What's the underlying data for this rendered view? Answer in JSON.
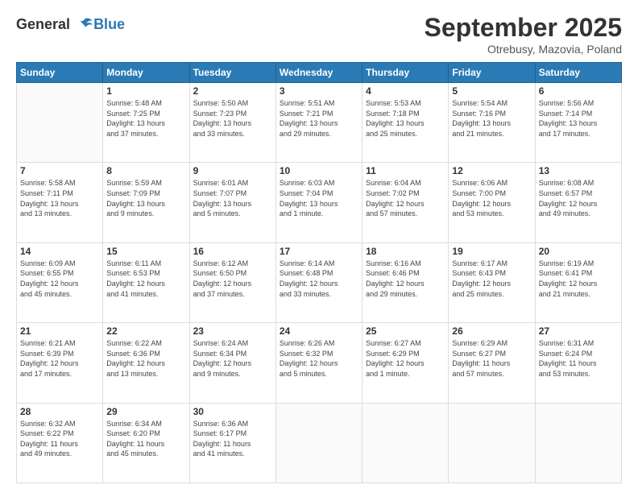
{
  "logo": {
    "line1": "General",
    "line2": "Blue"
  },
  "header": {
    "month": "September 2025",
    "location": "Otrebusy, Mazovia, Poland"
  },
  "weekdays": [
    "Sunday",
    "Monday",
    "Tuesday",
    "Wednesday",
    "Thursday",
    "Friday",
    "Saturday"
  ],
  "weeks": [
    [
      {
        "day": "",
        "info": ""
      },
      {
        "day": "1",
        "info": "Sunrise: 5:48 AM\nSunset: 7:25 PM\nDaylight: 13 hours\nand 37 minutes."
      },
      {
        "day": "2",
        "info": "Sunrise: 5:50 AM\nSunset: 7:23 PM\nDaylight: 13 hours\nand 33 minutes."
      },
      {
        "day": "3",
        "info": "Sunrise: 5:51 AM\nSunset: 7:21 PM\nDaylight: 13 hours\nand 29 minutes."
      },
      {
        "day": "4",
        "info": "Sunrise: 5:53 AM\nSunset: 7:18 PM\nDaylight: 13 hours\nand 25 minutes."
      },
      {
        "day": "5",
        "info": "Sunrise: 5:54 AM\nSunset: 7:16 PM\nDaylight: 13 hours\nand 21 minutes."
      },
      {
        "day": "6",
        "info": "Sunrise: 5:56 AM\nSunset: 7:14 PM\nDaylight: 13 hours\nand 17 minutes."
      }
    ],
    [
      {
        "day": "7",
        "info": "Sunrise: 5:58 AM\nSunset: 7:11 PM\nDaylight: 13 hours\nand 13 minutes."
      },
      {
        "day": "8",
        "info": "Sunrise: 5:59 AM\nSunset: 7:09 PM\nDaylight: 13 hours\nand 9 minutes."
      },
      {
        "day": "9",
        "info": "Sunrise: 6:01 AM\nSunset: 7:07 PM\nDaylight: 13 hours\nand 5 minutes."
      },
      {
        "day": "10",
        "info": "Sunrise: 6:03 AM\nSunset: 7:04 PM\nDaylight: 13 hours\nand 1 minute."
      },
      {
        "day": "11",
        "info": "Sunrise: 6:04 AM\nSunset: 7:02 PM\nDaylight: 12 hours\nand 57 minutes."
      },
      {
        "day": "12",
        "info": "Sunrise: 6:06 AM\nSunset: 7:00 PM\nDaylight: 12 hours\nand 53 minutes."
      },
      {
        "day": "13",
        "info": "Sunrise: 6:08 AM\nSunset: 6:57 PM\nDaylight: 12 hours\nand 49 minutes."
      }
    ],
    [
      {
        "day": "14",
        "info": "Sunrise: 6:09 AM\nSunset: 6:55 PM\nDaylight: 12 hours\nand 45 minutes."
      },
      {
        "day": "15",
        "info": "Sunrise: 6:11 AM\nSunset: 6:53 PM\nDaylight: 12 hours\nand 41 minutes."
      },
      {
        "day": "16",
        "info": "Sunrise: 6:12 AM\nSunset: 6:50 PM\nDaylight: 12 hours\nand 37 minutes."
      },
      {
        "day": "17",
        "info": "Sunrise: 6:14 AM\nSunset: 6:48 PM\nDaylight: 12 hours\nand 33 minutes."
      },
      {
        "day": "18",
        "info": "Sunrise: 6:16 AM\nSunset: 6:46 PM\nDaylight: 12 hours\nand 29 minutes."
      },
      {
        "day": "19",
        "info": "Sunrise: 6:17 AM\nSunset: 6:43 PM\nDaylight: 12 hours\nand 25 minutes."
      },
      {
        "day": "20",
        "info": "Sunrise: 6:19 AM\nSunset: 6:41 PM\nDaylight: 12 hours\nand 21 minutes."
      }
    ],
    [
      {
        "day": "21",
        "info": "Sunrise: 6:21 AM\nSunset: 6:39 PM\nDaylight: 12 hours\nand 17 minutes."
      },
      {
        "day": "22",
        "info": "Sunrise: 6:22 AM\nSunset: 6:36 PM\nDaylight: 12 hours\nand 13 minutes."
      },
      {
        "day": "23",
        "info": "Sunrise: 6:24 AM\nSunset: 6:34 PM\nDaylight: 12 hours\nand 9 minutes."
      },
      {
        "day": "24",
        "info": "Sunrise: 6:26 AM\nSunset: 6:32 PM\nDaylight: 12 hours\nand 5 minutes."
      },
      {
        "day": "25",
        "info": "Sunrise: 6:27 AM\nSunset: 6:29 PM\nDaylight: 12 hours\nand 1 minute."
      },
      {
        "day": "26",
        "info": "Sunrise: 6:29 AM\nSunset: 6:27 PM\nDaylight: 11 hours\nand 57 minutes."
      },
      {
        "day": "27",
        "info": "Sunrise: 6:31 AM\nSunset: 6:24 PM\nDaylight: 11 hours\nand 53 minutes."
      }
    ],
    [
      {
        "day": "28",
        "info": "Sunrise: 6:32 AM\nSunset: 6:22 PM\nDaylight: 11 hours\nand 49 minutes."
      },
      {
        "day": "29",
        "info": "Sunrise: 6:34 AM\nSunset: 6:20 PM\nDaylight: 11 hours\nand 45 minutes."
      },
      {
        "day": "30",
        "info": "Sunrise: 6:36 AM\nSunset: 6:17 PM\nDaylight: 11 hours\nand 41 minutes."
      },
      {
        "day": "",
        "info": ""
      },
      {
        "day": "",
        "info": ""
      },
      {
        "day": "",
        "info": ""
      },
      {
        "day": "",
        "info": ""
      }
    ]
  ]
}
